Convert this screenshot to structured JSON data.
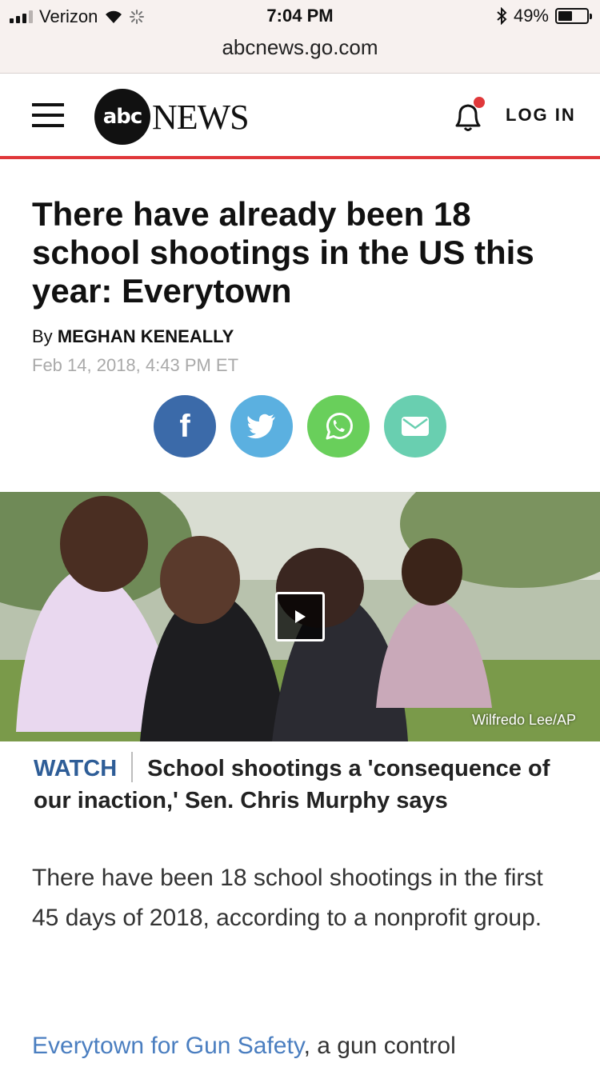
{
  "status_bar": {
    "carrier": "Verizon",
    "time": "7:04 PM",
    "battery_percent": "49%",
    "battery_level": 0.49,
    "icons": [
      "signal-icon",
      "wifi-icon",
      "loading-icon",
      "bluetooth-icon",
      "battery-icon"
    ]
  },
  "browser": {
    "url": "abcnews.go.com"
  },
  "header": {
    "logo_mark": "abc",
    "logo_word": "NEWS",
    "login_label": "LOG IN",
    "accent_color": "#e0383a"
  },
  "article": {
    "headline": "There have already been 18 school shootings in the US this year: Everytown",
    "byline_prefix": "By",
    "author": "MEGHAN KENEALLY",
    "date": "Feb 14, 2018, 4:43 PM ET",
    "share": [
      {
        "name": "facebook",
        "label": "f",
        "color": "#3b6aa9"
      },
      {
        "name": "twitter",
        "color": "#5bb0e0"
      },
      {
        "name": "whatsapp",
        "color": "#69cf5b"
      },
      {
        "name": "email",
        "color": "#69cfb0"
      }
    ],
    "image_credit": "Wilfredo Lee/AP",
    "watch_label": "WATCH",
    "watch_title": "School shootings a 'consequence of our inaction,' Sen. Chris Murphy says",
    "paragraph_1": "There have been 18 school shootings in the first 45 days of 2018, according to a nonprofit group.",
    "paragraph_2_link": "Everytown for Gun Safety",
    "paragraph_2_text": ", a gun control"
  }
}
